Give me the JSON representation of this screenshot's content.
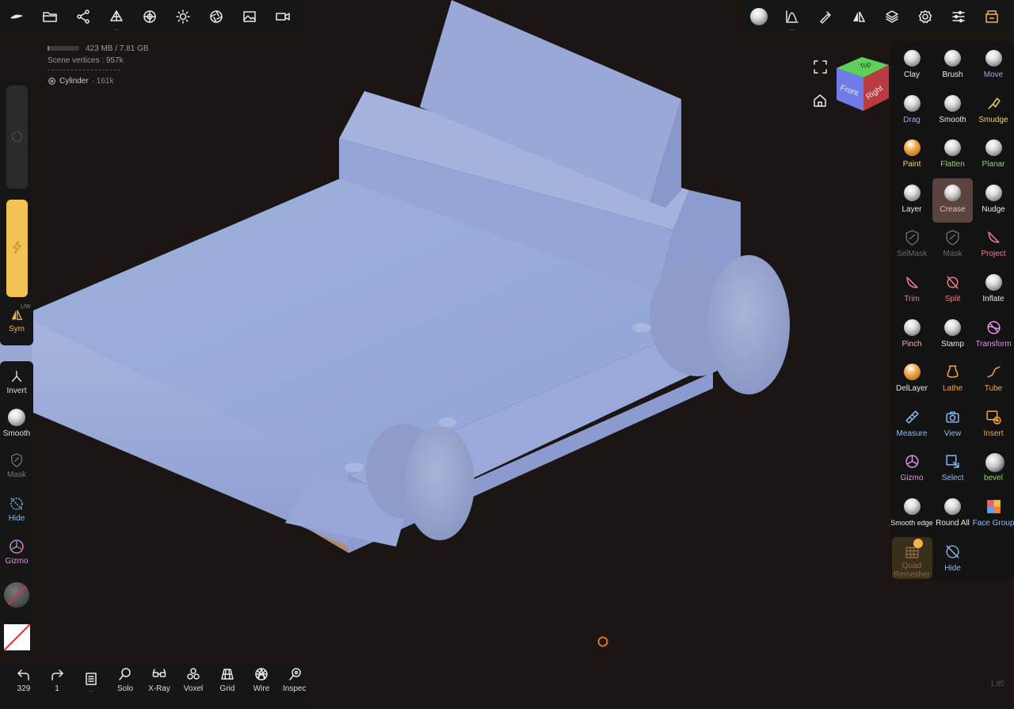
{
  "top_left_toolbar": {
    "items": [
      {
        "name": "logo-icon"
      },
      {
        "name": "folder-icon"
      },
      {
        "name": "share-icon"
      },
      {
        "name": "scene-icon",
        "dots": "..."
      },
      {
        "name": "material-icon"
      },
      {
        "name": "light-icon"
      },
      {
        "name": "aperture-icon"
      },
      {
        "name": "image-icon"
      },
      {
        "name": "camera-icon"
      }
    ]
  },
  "top_right_toolbar": {
    "items": [
      {
        "name": "active-tool-icon"
      },
      {
        "name": "curve-icon",
        "dots": "..."
      },
      {
        "name": "pen-icon"
      },
      {
        "name": "symmetry-icon"
      },
      {
        "name": "layers-icon"
      },
      {
        "name": "settings-icon"
      },
      {
        "name": "sliders-icon"
      },
      {
        "name": "store-icon"
      }
    ]
  },
  "stats": {
    "memory": "423 MB / 7.81 GB",
    "memory_fraction": 0.054,
    "vertices": "Scene vertices : 957k",
    "object_name": "Cylinder",
    "object_count": "· 161k"
  },
  "left_panel": {
    "sym_label": "Sym",
    "sym_sub": "L/W",
    "invert_label": "Invert",
    "smooth_label": "Smooth",
    "mask_label": "Mask",
    "hide_label": "Hide",
    "gizmo_label": "Gizmo"
  },
  "tools": [
    {
      "label": "Clay",
      "color": "#e8e8e8"
    },
    {
      "label": "Brush",
      "color": "#e8e8e8"
    },
    {
      "label": "Move",
      "color": "#a9a6e8"
    },
    {
      "label": "Drag",
      "color": "#a9a6e8"
    },
    {
      "label": "Smooth",
      "color": "#e8e8e8"
    },
    {
      "label": "Smudge",
      "color": "#f2d35a"
    },
    {
      "label": "Paint",
      "color": "#f2d35a"
    },
    {
      "label": "Flatten",
      "color": "#8bd36a"
    },
    {
      "label": "Planar",
      "color": "#8bd36a"
    },
    {
      "label": "Layer",
      "color": "#e8e8e8"
    },
    {
      "label": "Crease",
      "color": "#e8b7a9"
    },
    {
      "label": "Nudge",
      "color": "#e8e8e8"
    },
    {
      "label": "SelMask",
      "color": "#6a6a6a"
    },
    {
      "label": "Mask",
      "color": "#6a6a6a"
    },
    {
      "label": "Project",
      "color": "#ef7f87"
    },
    {
      "label": "Trim",
      "color": "#ef7f87"
    },
    {
      "label": "Split",
      "color": "#ef7f87"
    },
    {
      "label": "Inflate",
      "color": "#e8e8e8"
    },
    {
      "label": "Pinch",
      "color": "#e8b7a9"
    },
    {
      "label": "Stamp",
      "color": "#e8e8e8"
    },
    {
      "label": "Transform",
      "color": "#e391e0"
    },
    {
      "label": "DelLayer",
      "color": "#e8e8e8"
    },
    {
      "label": "Lathe",
      "color": "#f0a84a"
    },
    {
      "label": "Tube",
      "color": "#f0a84a"
    },
    {
      "label": "Measure",
      "color": "#8cbdf0"
    },
    {
      "label": "View",
      "color": "#8cbdf0"
    },
    {
      "label": "Insert",
      "color": "#f0a84a"
    },
    {
      "label": "Gizmo",
      "color": "#e391e0"
    },
    {
      "label": "Select",
      "color": "#8cbdf0"
    },
    {
      "label": "bevel",
      "color": "#8bd36a"
    },
    {
      "label": "Smooth edge",
      "color": "#e8e8e8"
    },
    {
      "label": "Round All",
      "color": "#e8e8e8"
    },
    {
      "label": "Face Group",
      "color": "#8cbdf0"
    },
    {
      "label": "Quad Remesher",
      "color": "#8a6a3a"
    },
    {
      "label": "Hide",
      "color": "#8cbdf0"
    }
  ],
  "viewcube": {
    "top": "Top",
    "front": "Front",
    "right": "Right"
  },
  "bottom_toolbar": {
    "undo_count": "329",
    "redo_count": "1",
    "history_dots": "...",
    "solo": "Solo",
    "xray": "X-Ray",
    "voxel": "Voxel",
    "grid": "Grid",
    "wire": "Wire",
    "inspect": "Inspect"
  },
  "version": "1.85"
}
